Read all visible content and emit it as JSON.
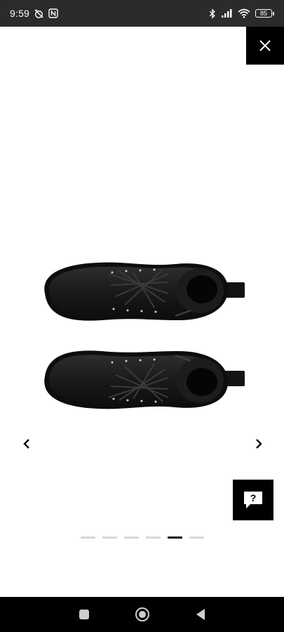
{
  "status_bar": {
    "time": "9:59",
    "battery_level": "85",
    "icons": [
      "alarm-off-icon",
      "nfc-icon",
      "bluetooth-icon",
      "signal-icon",
      "wifi-icon",
      "battery-icon"
    ]
  },
  "viewer": {
    "close_icon": "close-icon",
    "prev_icon": "chevron-left-icon",
    "next_icon": "chevron-right-icon",
    "help_icon": "help-chat-icon",
    "image": "black-lace-up-boots-top-view",
    "pagination": {
      "total": 6,
      "active_index": 5
    }
  },
  "nav_bar": {
    "icons": [
      "recent-apps-icon",
      "home-icon",
      "back-icon"
    ]
  },
  "colors": {
    "status_bar": "#2b2b2b",
    "close_button": "#000000",
    "active_dot": "#111111",
    "inactive_dot": "#d8d8d8"
  }
}
